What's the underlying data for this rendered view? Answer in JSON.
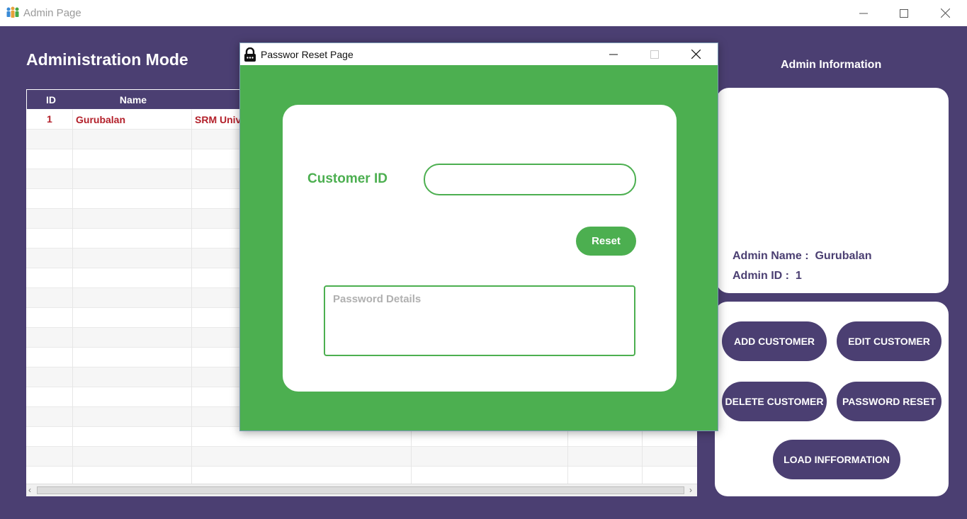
{
  "window": {
    "title": "Admin Page"
  },
  "page": {
    "heading": "Administration Mode"
  },
  "table": {
    "columns": [
      "ID",
      "Name"
    ],
    "rows": [
      {
        "id": "1",
        "name": "Gurubalan",
        "col3": "SRM Univ"
      }
    ]
  },
  "admin_panel": {
    "title": "Admin Information",
    "name_label": "Admin Name :",
    "name_value": "Gurubalan",
    "id_label": "Admin ID :",
    "id_value": "1"
  },
  "actions": {
    "add_customer": "ADD CUSTOMER",
    "edit_customer": "EDIT CUSTOMER",
    "delete_customer": "DELETE CUSTOMER",
    "password_reset": "PASSWORD RESET",
    "load_information": "LOAD INFFORMATION"
  },
  "dialog": {
    "title": "Passwor Reset Page",
    "customer_id_label": "Customer ID",
    "customer_id_value": "",
    "reset_label": "Reset",
    "password_placeholder": "Password Details"
  },
  "colors": {
    "primary_purple": "#4b3f72",
    "accent_green": "#4caf50",
    "row_text_red": "#b3202a"
  }
}
